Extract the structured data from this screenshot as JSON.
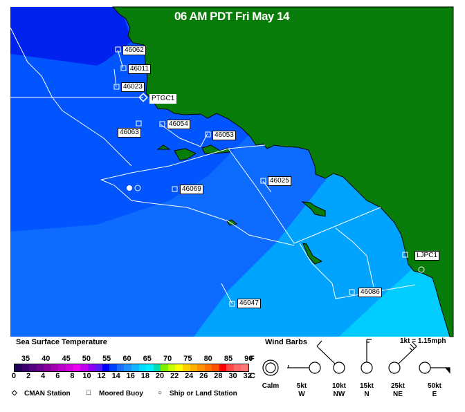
{
  "title": "06 AM PDT Fri May 14",
  "colors": {
    "land": "#087c08",
    "sst_0": "#0022ee",
    "sst_1": "#0055ff",
    "sst_2": "#0d6cff",
    "sst_3": "#00a4ff",
    "sst_4": "#00ccff"
  },
  "stations": [
    {
      "id": "46062",
      "type": "moored-buoy"
    },
    {
      "id": "46011",
      "type": "moored-buoy"
    },
    {
      "id": "46023",
      "type": "moored-buoy"
    },
    {
      "id": "PTGC1",
      "type": "cman-station"
    },
    {
      "id": "46063",
      "type": "moored-buoy"
    },
    {
      "id": "46054",
      "type": "moored-buoy"
    },
    {
      "id": "46053",
      "type": "moored-buoy"
    },
    {
      "id": "46069",
      "type": "moored-buoy"
    },
    {
      "id": "46025",
      "type": "moored-buoy"
    },
    {
      "id": "LJPC1",
      "type": "moored-buoy"
    },
    {
      "id": "46086",
      "type": "moored-buoy"
    },
    {
      "id": "46047",
      "type": "moored-buoy"
    }
  ],
  "legend": {
    "sst_title": "Sea Surface Temperature",
    "f_ticks": [
      "35",
      "40",
      "45",
      "50",
      "55",
      "60",
      "65",
      "70",
      "75",
      "80",
      "85",
      "90"
    ],
    "f_unit": "F",
    "c_ticks": [
      "0",
      "2",
      "4",
      "6",
      "8",
      "10",
      "12",
      "14",
      "16",
      "18",
      "20",
      "22",
      "24",
      "26",
      "28",
      "30",
      "32"
    ],
    "c_unit": "C",
    "colorbar": [
      "#20005a",
      "#3a0070",
      "#55007f",
      "#6e008e",
      "#8a009e",
      "#a200b0",
      "#bb00c8",
      "#d400dd",
      "#ee00f2",
      "#c000ee",
      "#8f00f4",
      "#5a18f4",
      "#0000ff",
      "#0044ff",
      "#1a70ff",
      "#2090ff",
      "#10b4ff",
      "#00ddff",
      "#00eeff",
      "#00ddb0",
      "#80ee00",
      "#c8ff00",
      "#ffff00",
      "#ffd000",
      "#ffb000",
      "#ff9000",
      "#ff7000",
      "#ff5000",
      "#ff0000",
      "#ff4848",
      "#ff6868",
      "#ff7878"
    ],
    "symbols": [
      "CMAN Station",
      "Moored Buoy",
      "Ship or Land Station"
    ],
    "wind_title": "Wind Barbs",
    "conversion": "1kt = 1.15mph",
    "wind_examples": [
      {
        "speed": "Calm",
        "dir": ""
      },
      {
        "speed": "5kt",
        "dir": "W"
      },
      {
        "speed": "10kt",
        "dir": "NW"
      },
      {
        "speed": "15kt",
        "dir": "N"
      },
      {
        "speed": "25kt",
        "dir": "NE"
      },
      {
        "speed": "50kt",
        "dir": "E"
      }
    ]
  }
}
